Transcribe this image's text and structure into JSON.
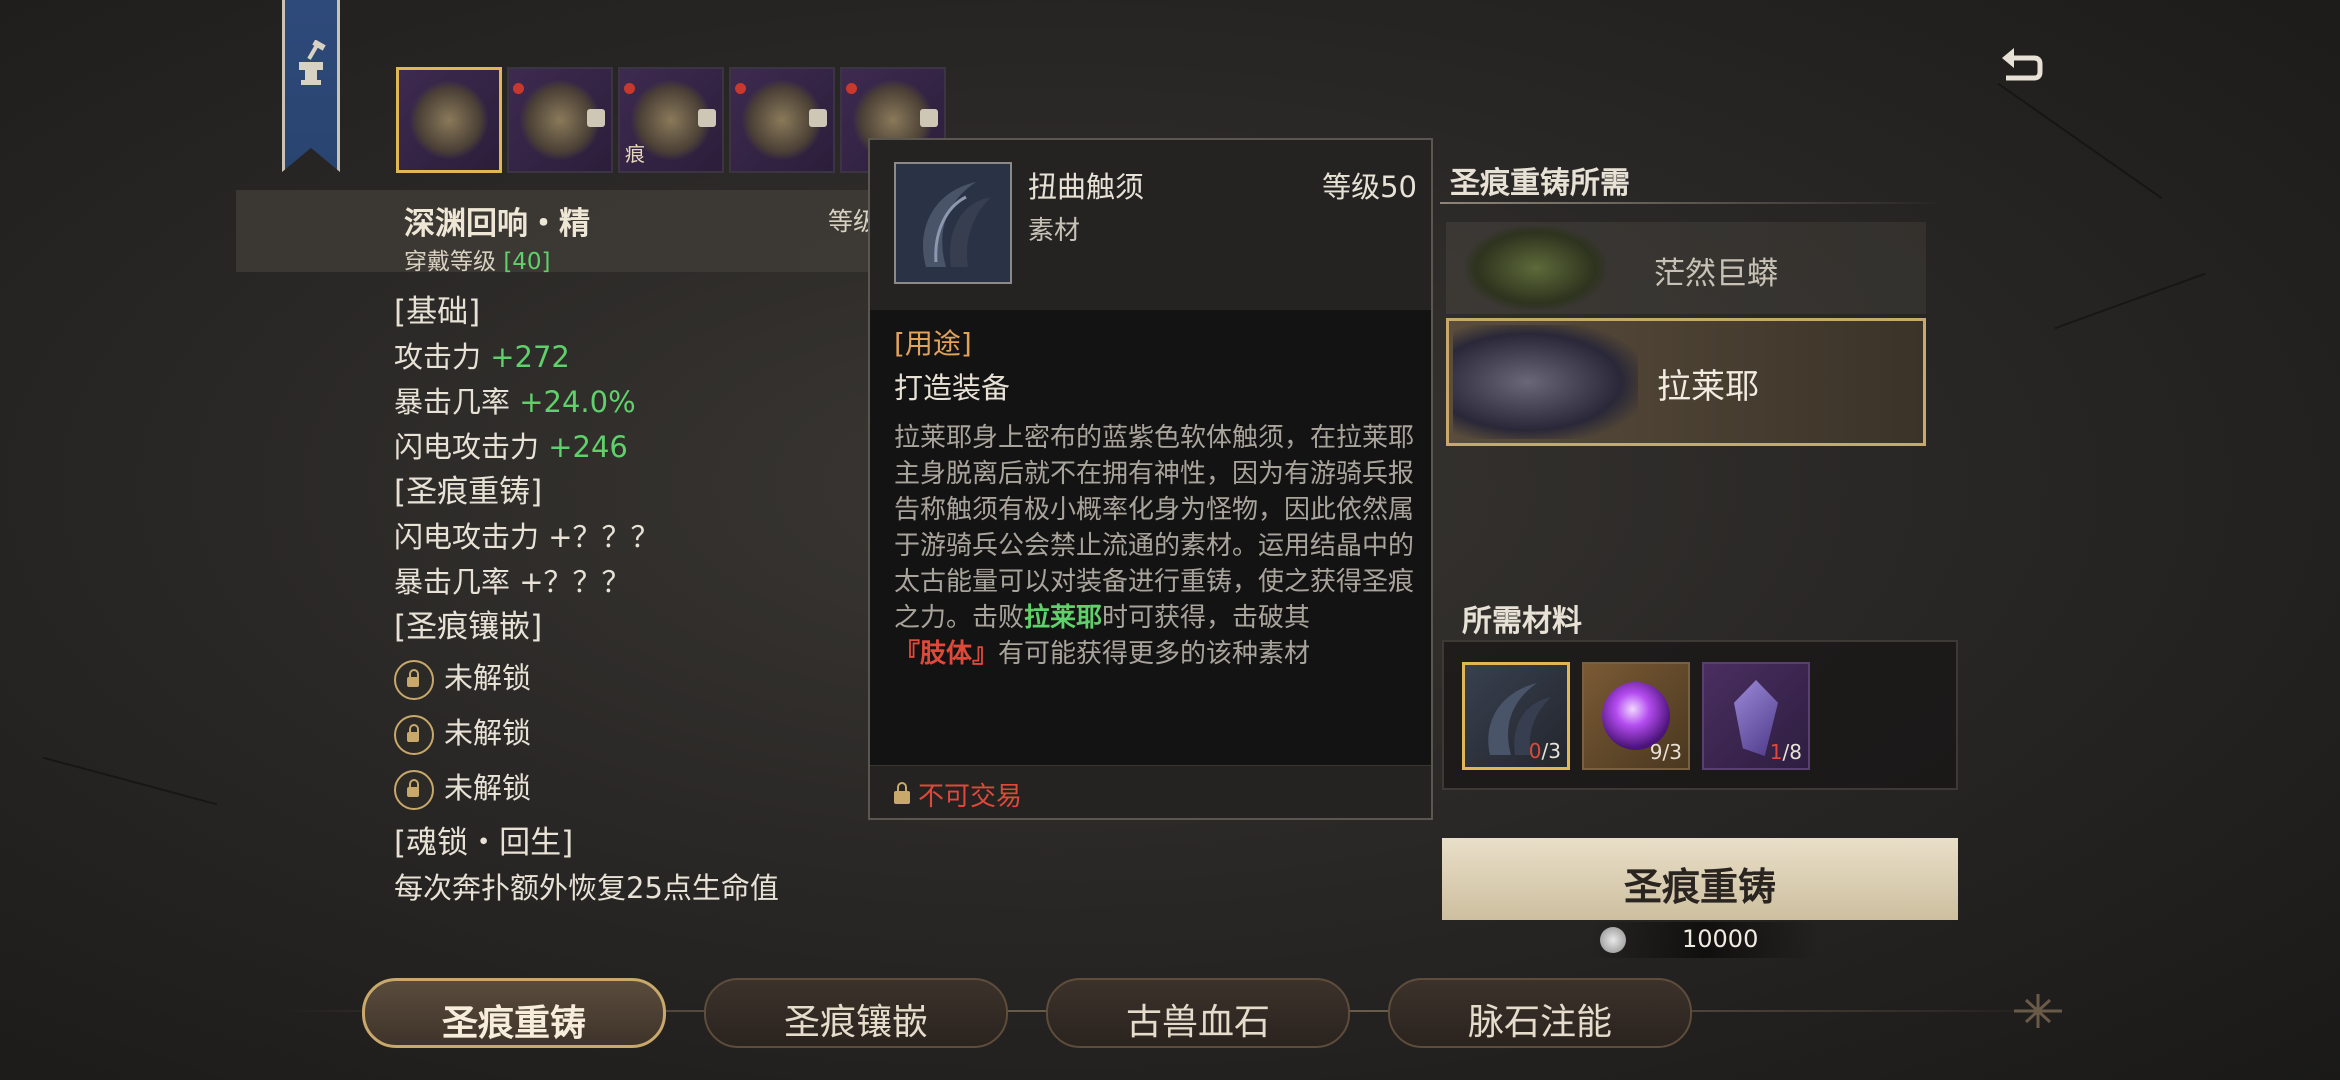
{
  "equipment": {
    "slots": [
      {
        "selected": true,
        "gem": false,
        "tag": ""
      },
      {
        "selected": false,
        "gem": true,
        "tag": ""
      },
      {
        "selected": false,
        "gem": true,
        "tag": "痕"
      },
      {
        "selected": false,
        "gem": true,
        "tag": ""
      },
      {
        "selected": false,
        "gem": true,
        "tag": ""
      }
    ]
  },
  "item": {
    "name": "深渊回响・精",
    "wear_level_label": "穿戴等级",
    "wear_level_value": "[40]",
    "partial_level_label": "等级"
  },
  "stats": {
    "base_header": "[基础]",
    "base": [
      {
        "label": "攻击力",
        "value": "+272"
      },
      {
        "label": "暴击几率",
        "value": "+24.0%"
      },
      {
        "label": "闪电攻击力",
        "value": "+246"
      }
    ],
    "recast_header": "[圣痕重铸]",
    "recast": [
      {
        "label": "闪电攻击力",
        "value": "+？？？"
      },
      {
        "label": "暴击几率",
        "value": "+？？？"
      }
    ],
    "inlay_header": "[圣痕镶嵌]",
    "inlay": [
      "未解锁",
      "未解锁",
      "未解锁"
    ],
    "soul_header": "[魂锁・回生]",
    "soul_text": "每次奔扑额外恢复25点生命值"
  },
  "tooltip": {
    "name": "扭曲触须",
    "type": "素材",
    "level": "等级50",
    "use_header": "[用途]",
    "use_value": "打造装备",
    "desc_1": "拉莱耶身上密布的蓝紫色软体触须，在拉莱耶主身脱离后就不在拥有神性，因为有游骑兵报告称触须有极小概率化身为怪物，因此依然属于游骑兵公会禁止流通的素材。运用结晶中的太古能量可以对装备进行重铸，使之获得圣痕之力。击败",
    "desc_boss": "拉莱耶",
    "desc_2": "时可获得，击破其",
    "desc_part": "『肢体』",
    "desc_3": "有可能获得更多的该种素材",
    "trade": "不可交易"
  },
  "recast_panel": {
    "header": "圣痕重铸所需",
    "bosses": [
      {
        "name": "茫然巨蟒",
        "selected": false
      },
      {
        "name": "拉莱耶",
        "selected": true
      }
    ],
    "materials_header": "所需材料",
    "materials": [
      {
        "icon": "tentacle-icon",
        "have": "0",
        "need": "/3",
        "short": true
      },
      {
        "icon": "purple-orb-icon",
        "have": "9",
        "need": "/3",
        "short": false
      },
      {
        "icon": "purple-crystal-icon",
        "have": "1",
        "need": "/8",
        "short": true
      }
    ],
    "button": "圣痕重铸",
    "cost": "10000"
  },
  "tabs": [
    {
      "label": "圣痕重铸",
      "active": true
    },
    {
      "label": "圣痕镶嵌",
      "active": false
    },
    {
      "label": "古兽血石",
      "active": false
    },
    {
      "label": "脉石注能",
      "active": false
    }
  ],
  "colors": {
    "green": "#5fd16a",
    "red": "#e0483a",
    "gold": "#e1b755",
    "use_orange": "#e1a35a"
  }
}
